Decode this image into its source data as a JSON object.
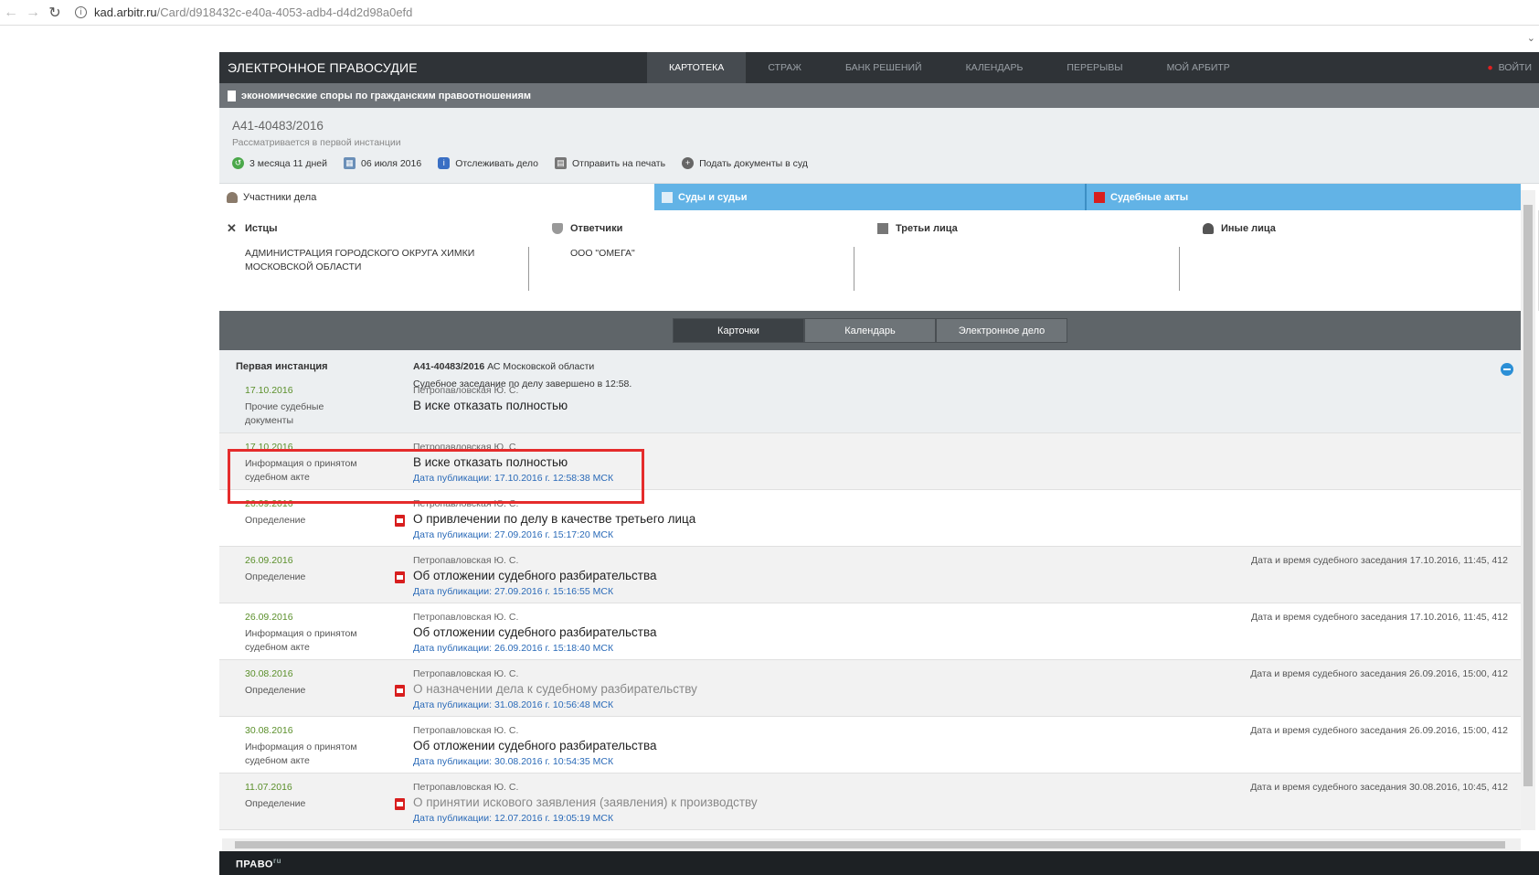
{
  "browser": {
    "url_host": "kad.arbitr.ru",
    "url_path": "/Card/d918432c-e40a-4053-adb4-d4d2d98a0efd"
  },
  "topnav": {
    "brand": "ЭЛЕКТРОННОЕ ПРАВОСУДИЕ",
    "tabs": [
      "КАРТОТЕКА",
      "СТРАЖ",
      "БАНК РЕШЕНИЙ",
      "КАЛЕНДАРЬ",
      "ПЕРЕРЫВЫ",
      "МОЙ АРБИТР"
    ],
    "login": "ВОЙТИ"
  },
  "category": "экономические споры по гражданским правоотношениям",
  "case": {
    "number": "А41-40483/2016",
    "status": "Рассматривается в первой инстанции",
    "duration": "3 месяца 11 дней",
    "date": "06 июля 2016",
    "track": "Отслеживать дело",
    "print": "Отправить на печать",
    "submit": "Подать документы в суд"
  },
  "party_tabs": [
    "Участники дела",
    "Суды и судьи",
    "Судебные акты"
  ],
  "parties": {
    "plaintiffs_label": "Истцы",
    "plaintiff": "АДМИНИСТРАЦИЯ ГОРОДСКОГО ОКРУГА ХИМКИ МОСКОВСКОЙ ОБЛАСТИ",
    "defendants_label": "Ответчики",
    "defendant": "ООО \"ОМЕГА\"",
    "third_label": "Третьи лица",
    "other_label": "Иные лица"
  },
  "card_tabs": [
    "Карточки",
    "Календарь",
    "Электронное дело"
  ],
  "instance": {
    "label": "Первая инстанция",
    "case_no": "А41-40483/2016",
    "court": " АС Московской области",
    "status": "Судебное заседание по делу завершено в 12:58."
  },
  "rows": [
    {
      "date": "17.10.2016",
      "type": "Прочие судебные документы",
      "judge": "Петропавловская Ю. С.",
      "title": "В иске отказать полностью",
      "pub": "",
      "hearing": "",
      "pdf": false,
      "gray": false
    },
    {
      "date": "17.10.2016",
      "type": "Информация о принятом судебном акте",
      "judge": "Петропавловская Ю. С.",
      "title": "В иске отказать полностью",
      "pub": "Дата публикации: 17.10.2016 г. 12:58:38 МСК",
      "hearing": "",
      "pdf": false,
      "gray": false
    },
    {
      "date": "26.09.2016",
      "type": "Определение",
      "judge": "Петропавловская Ю. С.",
      "title": "О привлечении по делу в качестве третьего лица",
      "pub": "Дата публикации: 27.09.2016 г. 15:17:20 МСК",
      "hearing": "",
      "pdf": true,
      "gray": false
    },
    {
      "date": "26.09.2016",
      "type": "Определение",
      "judge": "Петропавловская Ю. С.",
      "title": "Об отложении судебного разбирательства",
      "pub": "Дата публикации: 27.09.2016 г. 15:16:55 МСК",
      "hearing": "Дата и время судебного заседания 17.10.2016, 11:45, 412",
      "pdf": true,
      "gray": false
    },
    {
      "date": "26.09.2016",
      "type": "Информация о принятом судебном акте",
      "judge": "Петропавловская Ю. С.",
      "title": "Об отложении судебного разбирательства",
      "pub": "Дата публикации: 26.09.2016 г. 15:18:40 МСК",
      "hearing": "Дата и время судебного заседания 17.10.2016, 11:45, 412",
      "pdf": false,
      "gray": false
    },
    {
      "date": "30.08.2016",
      "type": "Определение",
      "judge": "Петропавловская Ю. С.",
      "title": "О назначении дела к судебному разбирательству",
      "pub": "Дата публикации: 31.08.2016 г. 10:56:48 МСК",
      "hearing": "Дата и время судебного заседания 26.09.2016, 15:00, 412",
      "pdf": true,
      "gray": true
    },
    {
      "date": "30.08.2016",
      "type": "Информация о принятом судебном акте",
      "judge": "Петропавловская Ю. С.",
      "title": "Об отложении судебного разбирательства",
      "pub": "Дата публикации: 30.08.2016 г. 10:54:35 МСК",
      "hearing": "Дата и время судебного заседания 26.09.2016, 15:00, 412",
      "pdf": false,
      "gray": false
    },
    {
      "date": "11.07.2016",
      "type": "Определение",
      "judge": "Петропавловская Ю. С.",
      "title": "О принятии искового заявления (заявления) к производству",
      "pub": "Дата публикации: 12.07.2016 г. 19:05:19 МСК",
      "hearing": "Дата и время судебного заседания 30.08.2016, 10:45, 412",
      "pdf": true,
      "gray": true
    }
  ],
  "footer": {
    "logo": "ПРАВО",
    "logo_suffix": "ru"
  },
  "colors": {
    "accent_blue": "#62b3e6",
    "date_green": "#5a8f2a",
    "link_blue": "#2a6ab8",
    "highlight": "#e52c2c"
  }
}
